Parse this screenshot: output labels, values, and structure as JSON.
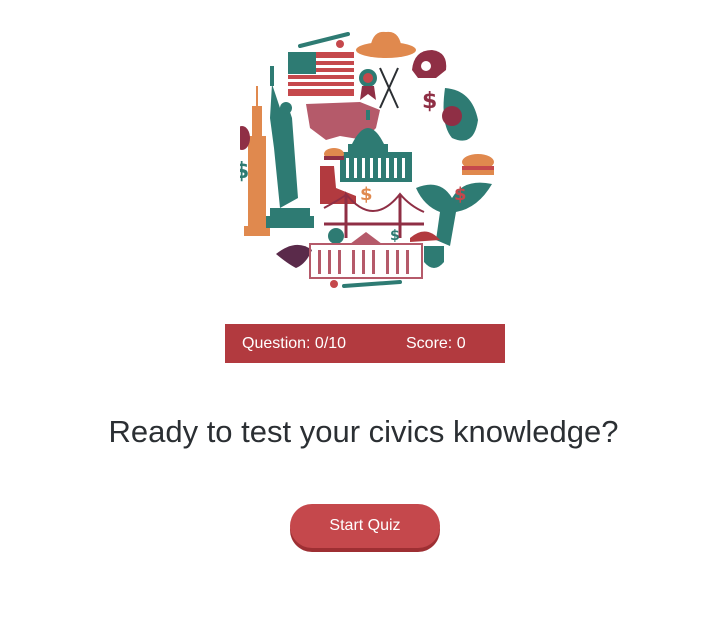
{
  "status": {
    "question_label": "Question: 0/10",
    "score_label": "Score: 0"
  },
  "prompt": "Ready to test your civics knowledge?",
  "start_button": "Start Quiz",
  "colors": {
    "accent": "#b23a3f",
    "teal": "#2e7b73",
    "orange": "#e0894e",
    "maroon": "#8f2f45"
  },
  "hero_icons": [
    "flag-icon",
    "liberty-statue-icon",
    "capitol-icon",
    "eagle-icon",
    "white-house-icon",
    "cowboy-hat-icon",
    "football-helmet-icon",
    "golden-gate-bridge-icon",
    "usa-map-icon",
    "dollar-icon",
    "burger-icon",
    "baseball-bat-icon"
  ]
}
